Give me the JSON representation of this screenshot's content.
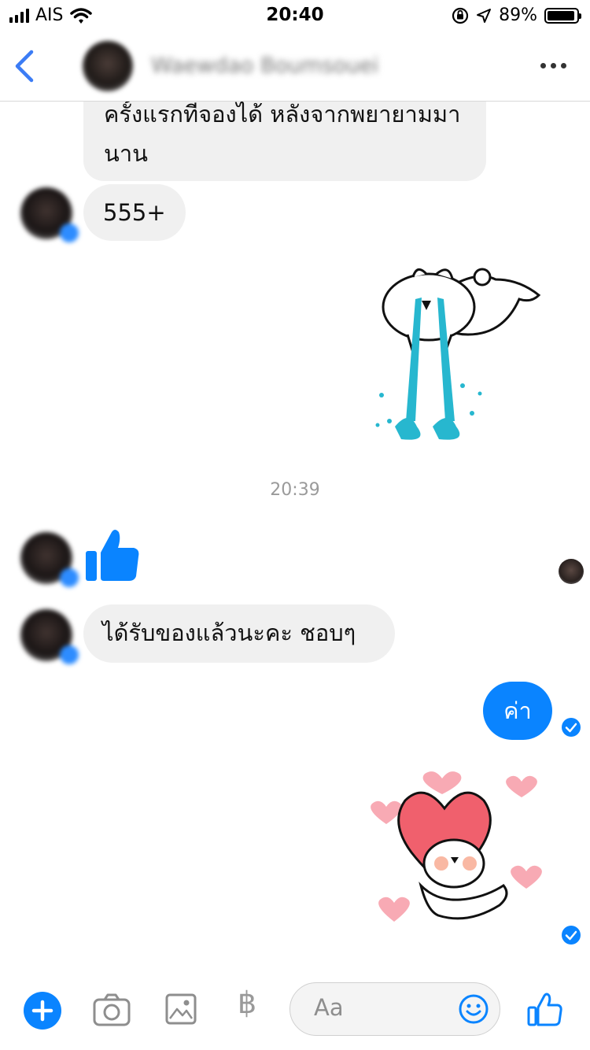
{
  "status_bar": {
    "carrier": "AIS",
    "time": "20:40",
    "battery": "89%"
  },
  "header": {
    "contact_name": "Waewdao Boumsouei"
  },
  "messages": {
    "m1_text": "ครั้งแรกที่จองได้ หลังจากพยายามมานาน",
    "m2_text": "555+",
    "timestamp": "20:39",
    "m3_text": "ได้รับของแล้วนะคะ ชอบๆ",
    "m4_text": "ค่า"
  },
  "composer": {
    "placeholder": "Aa",
    "currency_symbol": "฿"
  },
  "colors": {
    "accent": "#0a84ff",
    "incoming_bubble": "#f0f0f0",
    "sticker_water": "#27b7cf",
    "heart": "#f0606d"
  },
  "icons": [
    "signal-icon",
    "wifi-icon",
    "orientation-lock-icon",
    "location-icon",
    "battery-icon",
    "back-chevron-icon",
    "more-icon",
    "thumbs-up-icon",
    "check-icon",
    "plus-icon",
    "camera-icon",
    "gallery-icon",
    "smiley-icon",
    "like-outline-icon"
  ]
}
